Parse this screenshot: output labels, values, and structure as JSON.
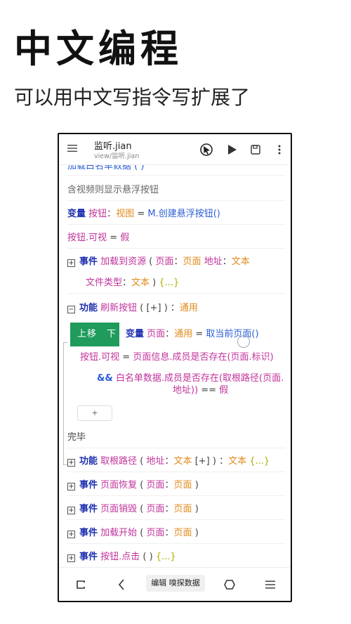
{
  "promo": {
    "headline": "中文编程",
    "subline": "可以用中文写指令写扩展了"
  },
  "appbar": {
    "title": "监听.jian",
    "path": "view/监听.jian"
  },
  "code": {
    "line0": "加载白名单数据 ( )",
    "line1": "含视频则显示悬浮按钮",
    "line2": {
      "kw": "变量",
      "name": "按钮",
      "colon": "：",
      "type": "视图",
      "eq": " = ",
      "call": "M.创建悬浮按钮()"
    },
    "line3": {
      "obj": "按钮",
      "prop": ".可视",
      "eq": " = ",
      "val": "假"
    },
    "line4": {
      "toggle": "⊞",
      "kw": "事件",
      "name": "加载到资源",
      "open": " ( ",
      "p1": "页面",
      "c1": "：",
      "t1": "页面",
      "p2": " 地址",
      "c2": "：",
      "t2": "文本"
    },
    "line5": {
      "p3": "文件类型",
      "c3": "：",
      "t3": "文本",
      "close": " ) ",
      "fold": "{...}"
    },
    "line6": {
      "toggle": "⊟",
      "kw": "功能",
      "name": "刷新按钮",
      "open": " ( ",
      "arr": "[+]",
      "close": " ) ",
      "colon": "：",
      "type": "通用"
    },
    "move": {
      "up": "上移",
      "down": "下"
    },
    "line7": {
      "kw": "变量",
      "name": "页面",
      "colon": "：",
      "type": "通用",
      "eq": " = ",
      "call": "取当前页面()"
    },
    "line8": {
      "obj": "按钮",
      "prop": ".可视",
      "eq": " = ",
      "expr": "页面信息.成员是否存在(页面.标识)"
    },
    "line9": {
      "and": "&&",
      "obj": "白名单数据",
      "expr": ".成员是否存在(取根路径(页面."
    },
    "line10": {
      "expr": "地址))",
      "eq": " == ",
      "val": "假"
    },
    "add_label": "+",
    "line11": "完毕",
    "line12": {
      "toggle": "⊞",
      "kw": "功能",
      "name": "取根路径",
      "open": " ( ",
      "p1": "地址",
      "c1": "：",
      "t1": "文本",
      "arr": " [+]",
      "close": " ) ",
      "colon": "：",
      "type": "文本",
      "fold": " {...}"
    },
    "line13": {
      "toggle": "⊞",
      "kw": "事件",
      "name": "页面恢复",
      "open": " ( ",
      "p1": "页面",
      "c1": "：",
      "t1": "页面",
      "close": " )"
    },
    "line14": {
      "toggle": "⊞",
      "kw": "事件",
      "name": "页面销毁",
      "open": " ( ",
      "p1": "页面",
      "c1": "：",
      "t1": "页面",
      "close": " )"
    },
    "line15": {
      "toggle": "⊞",
      "kw": "事件",
      "name": "加载开始",
      "open": " ( ",
      "p1": "页面",
      "c1": "：",
      "t1": "页面",
      "close": " )"
    },
    "line16": {
      "toggle": "⊞",
      "kw": "事件",
      "name": "按钮.点击",
      "open": " ( ) ",
      "fold": "{...}"
    }
  },
  "bottombar": {
    "edit_label": "编辑 嗅探数据"
  },
  "colors": {
    "keyword": "#1e2fb0",
    "variable": "#c0339b",
    "type": "#e08a1a",
    "call": "#2c5fd6",
    "move_button": "#1f9b5c"
  },
  "icons": [
    "menu-icon",
    "cursor-icon",
    "play-icon",
    "save-icon",
    "more-icon",
    "recent-apps-icon",
    "back-icon",
    "home-icon",
    "list-icon"
  ]
}
